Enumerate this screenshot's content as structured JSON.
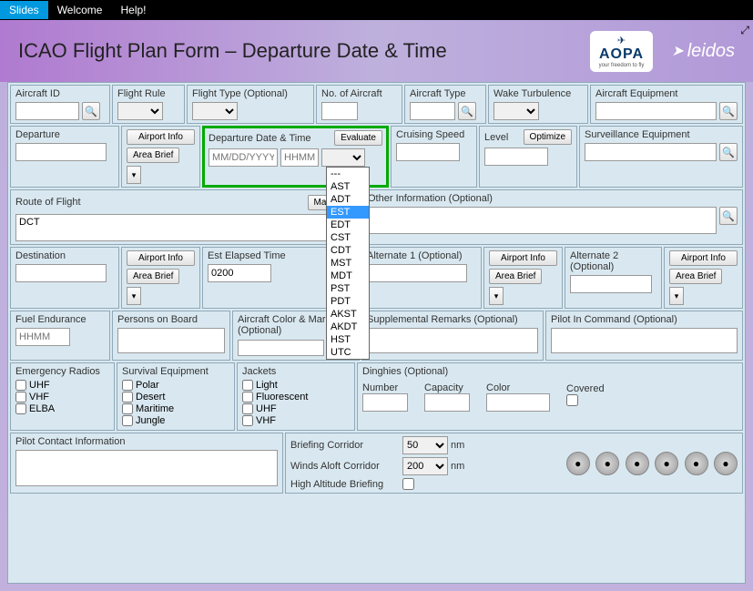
{
  "topbar": {
    "slides": "Slides",
    "welcome": "Welcome",
    "help": "Help!"
  },
  "title": "ICAO Flight Plan Form – Departure Date & Time",
  "logos": {
    "aopa": "AOPA",
    "aopa_sub": "your freedom to fly",
    "leidos": "leidos"
  },
  "row1": {
    "aircraft_id": "Aircraft ID",
    "flight_rule": "Flight Rule",
    "flight_type": "Flight Type (Optional)",
    "no_aircraft": "No. of Aircraft",
    "aircraft_type": "Aircraft Type",
    "wake": "Wake Turbulence",
    "equipment": "Aircraft Equipment"
  },
  "row2": {
    "departure": "Departure",
    "airport_info": "Airport Info",
    "area_brief": "Area Brief",
    "dep_datetime": "Departure Date & Time",
    "date_ph": "MM/DD/YYYY",
    "time_ph": "HHMM",
    "evaluate": "Evaluate",
    "cruising": "Cruising Speed",
    "level": "Level",
    "optimize": "Optimize",
    "surveillance": "Surveillance Equipment"
  },
  "tz_options": [
    "---",
    "AST",
    "ADT",
    "EST",
    "EDT",
    "CST",
    "CDT",
    "MST",
    "MDT",
    "PST",
    "PDT",
    "AKST",
    "AKDT",
    "HST",
    "UTC"
  ],
  "tz_selected": "EST",
  "row3": {
    "route": "Route of Flight",
    "route_val": "DCT",
    "map": "Map",
    "other": "Other Information (Optional)"
  },
  "row4": {
    "destination": "Destination",
    "est_elapsed": "Est Elapsed Time",
    "est_val": "0200",
    "alt1": "Alternate 1 (Optional)",
    "alt2": "Alternate 2 (Optional)"
  },
  "row5": {
    "fuel": "Fuel Endurance",
    "fuel_ph": "HHMM",
    "persons": "Persons on Board",
    "color": "Aircraft Color & Markings (Optional)",
    "remarks": "Supplemental Remarks (Optional)",
    "pilot": "Pilot In Command (Optional)"
  },
  "row6": {
    "emergency": "Emergency Radios",
    "er_items": [
      "UHF",
      "VHF",
      "ELBA"
    ],
    "survival": "Survival Equipment",
    "sv_items": [
      "Polar",
      "Desert",
      "Maritime",
      "Jungle"
    ],
    "jackets": "Jackets",
    "jk_items": [
      "Light",
      "Fluorescent",
      "UHF",
      "VHF"
    ],
    "dinghies": "Dinghies (Optional)",
    "number": "Number",
    "capacity": "Capacity",
    "colord": "Color",
    "covered": "Covered"
  },
  "row7": {
    "contact": "Pilot Contact Information",
    "briefing": "Briefing Corridor",
    "briefing_val": "50",
    "winds": "Winds Aloft Corridor",
    "winds_val": "200",
    "nm": "nm",
    "high_alt": "High Altitude Briefing"
  }
}
